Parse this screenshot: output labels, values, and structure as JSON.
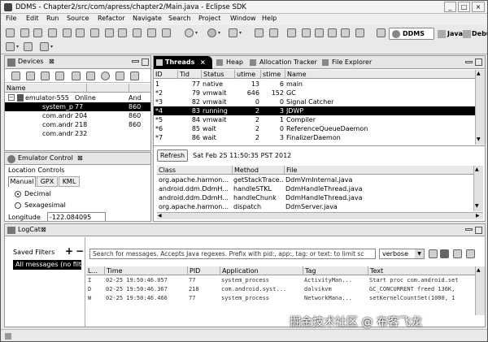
{
  "window": {
    "title": "DDMS - Chapter2/src/com/apress/chapter2/Main.java - Eclipse SDK",
    "controls": [
      "_",
      "□",
      "×"
    ]
  },
  "menu": [
    "File",
    "Edit",
    "Run",
    "Source",
    "Refactor",
    "Navigate",
    "Search",
    "Project",
    "Window",
    "Help"
  ],
  "perspectives": {
    "ddms": "DDMS",
    "java": "Java",
    "debug": "Debu"
  },
  "devices": {
    "title": "Devices",
    "columns": [
      "Name",
      "",
      ""
    ],
    "rows": [
      [
        "emulator-555",
        "Online",
        "And"
      ],
      [
        "system_p",
        "77",
        "860"
      ],
      [
        "com.andr",
        "204",
        "860"
      ],
      [
        "com.andr",
        "218",
        "860"
      ],
      [
        "com.andr",
        "232",
        ""
      ]
    ]
  },
  "emulator_control": {
    "title": "Emulator Control",
    "section": "Location Controls",
    "tabs": [
      "Manual",
      "GPX",
      "KML"
    ],
    "radio1": "Decimal",
    "radio2": "Sexagesimal",
    "longitude_label": "Longitude",
    "longitude_value": "-122.084095"
  },
  "threads": {
    "tabs": [
      "Threads",
      "Heap",
      "Allocation Tracker",
      "File Explorer"
    ],
    "columns": [
      "ID",
      "Tid",
      "Status",
      "utime",
      "stime",
      "Name"
    ],
    "rows": [
      [
        "1",
        "77",
        "native",
        "13",
        "6",
        "main"
      ],
      [
        "*2",
        "79",
        "vmwait",
        "646",
        "152",
        "GC"
      ],
      [
        "*3",
        "82",
        "vmwait",
        "0",
        "0",
        "Signal Catcher"
      ],
      [
        "*4",
        "83",
        "running",
        "2",
        "3",
        "JDWP"
      ],
      [
        "*5",
        "84",
        "vmwait",
        "2",
        "1",
        "Compiler"
      ],
      [
        "*6",
        "85",
        "wait",
        "2",
        "0",
        "ReferenceQueueDaemon"
      ],
      [
        "*7",
        "86",
        "wait",
        "2",
        "3",
        "FinalizerDaemon"
      ]
    ],
    "selected_row": 3
  },
  "refresh": {
    "label": "Refresh",
    "timestamp": "Sat Feb 25 11:50:35 PST 2012"
  },
  "stack": {
    "columns": [
      "Class",
      "Method",
      "File"
    ],
    "rows": [
      [
        "org.apache.harmon...",
        "getStackTrace...",
        "DdmVmInternal.java"
      ],
      [
        "android.ddm.DdmH...",
        "handleSTKL",
        "DdmHandleThread.java"
      ],
      [
        "android.ddm.DdmH...",
        "handleChunk",
        "DdmHandleThread.java"
      ],
      [
        "org.apache.harmon...",
        "dispatch",
        "DdmServer.java"
      ]
    ]
  },
  "logcat": {
    "title": "LogCat",
    "saved_filters": "Saved Filters",
    "all_messages": "All messages (no filt",
    "search_placeholder": "Search for messages. Accepts Java regexes. Prefix with pid:, app:, tag: or text: to limit sc",
    "level": "verbose",
    "columns": [
      "L...",
      "Time",
      "PID",
      "Application",
      "Tag",
      "Text"
    ],
    "rows": [
      [
        "I",
        "02-25 19:50:46.057",
        "77",
        "system_process",
        "ActivityMan...",
        "Start proc com.android.set"
      ],
      [
        "D",
        "02-25 19:50:46.367",
        "218",
        "com.android.syst...",
        "dalvikvm",
        "GC_CONCURRENT freed 136K,"
      ],
      [
        "W",
        "02-25 19:50:46.466",
        "77",
        "system_process",
        "NetworkMana...",
        "setKernelCountSet(1000, 1"
      ]
    ]
  },
  "watermark": "掘金技术社区 @ 布客飞龙",
  "colors": {
    "selected": "#000000",
    "selected_text": "#ffffff",
    "tab_active": "#ffffff"
  }
}
